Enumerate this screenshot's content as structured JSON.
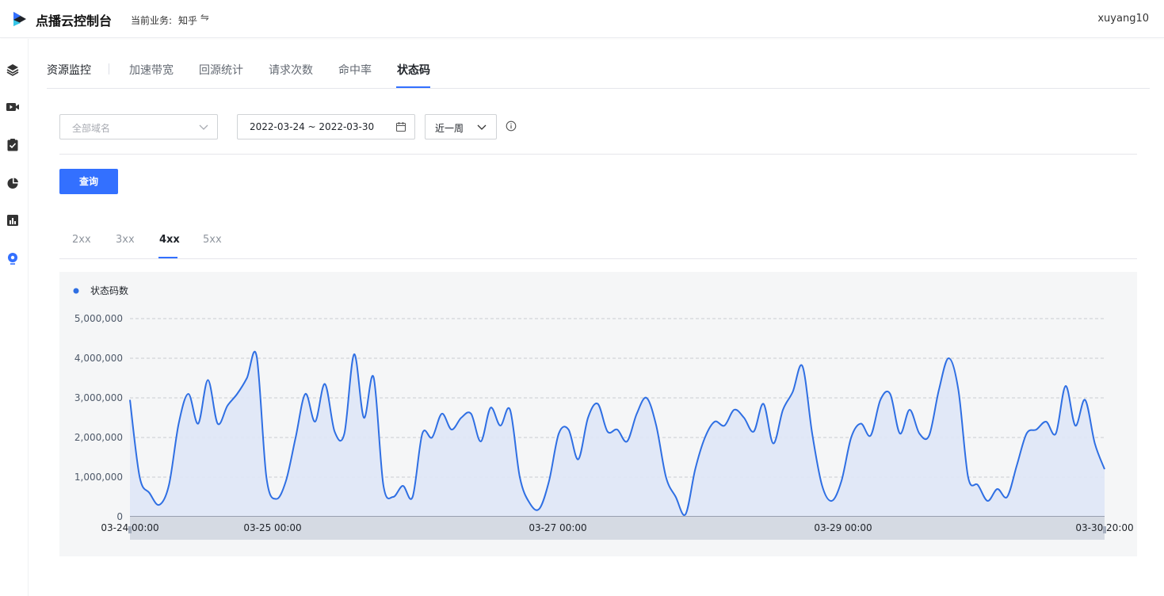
{
  "header": {
    "app_title": "点播云控制台",
    "business_label": "当前业务:",
    "business_value": "知乎",
    "switch_glyph": "⇋",
    "user": "xuyang10"
  },
  "sidebar": {
    "icons": [
      "layers-icon",
      "video-icon",
      "clipboard-check-icon",
      "pie-chart-icon",
      "bar-chart-icon",
      "location-pin-icon"
    ],
    "active_index": 5
  },
  "tabs": {
    "items": [
      {
        "label": "资源监控"
      },
      {
        "label": "加速带宽"
      },
      {
        "label": "回源统计"
      },
      {
        "label": "请求次数"
      },
      {
        "label": "命中率"
      },
      {
        "label": "状态码"
      }
    ],
    "active": "状态码"
  },
  "filters": {
    "domain_placeholder": "全部域名",
    "date_range": "2022-03-24 ~ 2022-03-30",
    "range_value": "近一周",
    "query_label": "查询"
  },
  "code_tabs": {
    "items": [
      "2xx",
      "3xx",
      "4xx",
      "5xx"
    ],
    "active": "4xx"
  },
  "colors": {
    "accent": "#3370ff",
    "line": "#2f6fe3",
    "area": "#dfe7f6"
  },
  "chart_data": {
    "type": "area",
    "legend": "状态码数",
    "legend_position": "top-left",
    "ylim": [
      0,
      5000000
    ],
    "y_ticks": [
      "0",
      "1,000,000",
      "2,000,000",
      "3,000,000",
      "4,000,000",
      "5,000,000"
    ],
    "x_tick_labels": [
      "03-24 00:00",
      "03-25 00:00",
      "03-27 00:00",
      "03-29 00:00",
      "03-30 20:00"
    ],
    "grid": true,
    "x_hours": [
      0,
      2,
      4,
      6,
      8,
      10,
      12,
      14,
      16,
      18,
      20,
      22,
      24,
      26,
      28,
      30,
      32,
      34,
      36,
      38,
      40,
      42,
      44,
      46,
      48,
      50,
      52,
      54,
      56,
      58,
      60,
      62,
      64,
      66,
      68,
      70,
      72,
      74,
      76,
      78,
      80,
      82,
      84,
      86,
      88,
      90,
      92,
      94,
      96,
      98,
      100,
      102,
      104,
      106,
      108,
      110,
      112,
      114,
      116,
      118,
      120,
      122,
      124,
      126,
      128,
      130,
      132,
      134,
      136,
      138,
      140,
      142,
      144,
      146,
      148,
      150,
      152,
      154,
      156,
      158,
      160,
      162,
      164
    ],
    "series": [
      {
        "name": "状态码数",
        "values": [
          2950000,
          1000000,
          600000,
          300000,
          800000,
          2350000,
          3100000,
          2350000,
          3450000,
          2350000,
          2800000,
          3100000,
          3500000,
          4050000,
          1000000,
          450000,
          900000,
          2000000,
          3100000,
          2400000,
          3350000,
          2150000,
          2100000,
          4100000,
          2500000,
          3520000,
          800000,
          500000,
          780000,
          500000,
          2100000,
          2000000,
          2600000,
          2200000,
          2500000,
          2600000,
          1900000,
          2750000,
          2300000,
          2700000,
          1000000,
          350000,
          200000,
          900000,
          2100000,
          2200000,
          1450000,
          2500000,
          2850000,
          2150000,
          2200000,
          1900000,
          2600000,
          3000000,
          2300000,
          1000000,
          500000,
          60000,
          1200000,
          2000000,
          2400000,
          2300000,
          2700000,
          2500000,
          2150000,
          2850000,
          1850000,
          2700000,
          3150000,
          3800000,
          2100000,
          800000,
          400000,
          900000,
          2000000,
          2350000,
          2050000,
          2950000,
          3100000,
          2100000,
          2700000,
          2100000,
          2050000,
          3200000,
          4000000,
          3200000,
          1000000,
          800000,
          400000,
          700000,
          500000,
          1300000,
          2100000,
          2200000,
          2400000,
          2100000,
          3300000,
          2300000,
          2950000,
          1850000,
          1200000
        ]
      }
    ]
  }
}
